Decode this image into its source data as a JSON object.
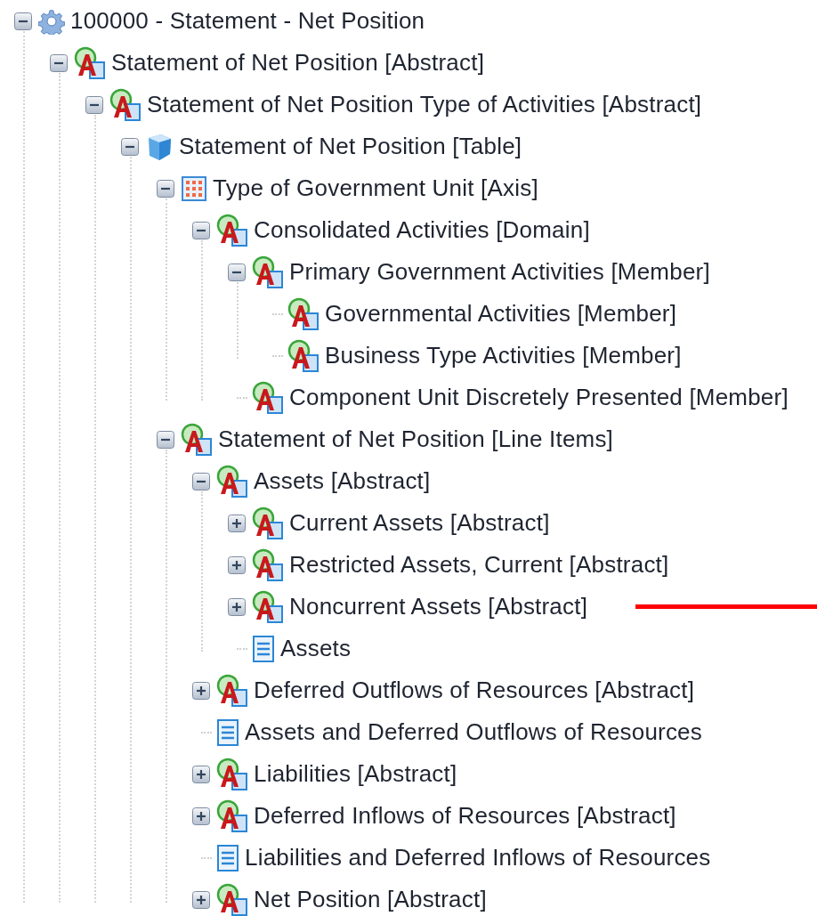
{
  "tree": {
    "label": "100000 - Statement - Net Position",
    "kind": "network",
    "expanded": true,
    "children": [
      {
        "label": "Statement of Net Position [Abstract]",
        "kind": "abstract",
        "expanded": true,
        "children": [
          {
            "label": "Statement of Net Position Type of Activities [Abstract]",
            "kind": "abstract",
            "expanded": true,
            "children": [
              {
                "label": "Statement of Net Position [Table]",
                "kind": "table",
                "expanded": true,
                "children": [
                  {
                    "label": "Type of Government Unit [Axis]",
                    "kind": "axis",
                    "expanded": true,
                    "children": [
                      {
                        "label": "Consolidated Activities [Domain]",
                        "kind": "abstract",
                        "expanded": true,
                        "children": [
                          {
                            "label": "Primary Government Activities [Member]",
                            "kind": "abstract",
                            "expanded": true,
                            "children": [
                              {
                                "label": "Governmental Activities [Member]",
                                "kind": "abstract"
                              },
                              {
                                "label": "Business Type Activities [Member]",
                                "kind": "abstract"
                              }
                            ]
                          },
                          {
                            "label": "Component Unit Discretely Presented [Member]",
                            "kind": "abstract"
                          }
                        ]
                      }
                    ]
                  },
                  {
                    "label": "Statement of Net Position [Line Items]",
                    "kind": "abstract",
                    "expanded": true,
                    "children": [
                      {
                        "label": "Assets [Abstract]",
                        "kind": "abstract",
                        "expanded": true,
                        "children": [
                          {
                            "label": "Current Assets [Abstract]",
                            "kind": "abstract",
                            "expanded": false
                          },
                          {
                            "label": "Restricted Assets, Current [Abstract]",
                            "kind": "abstract",
                            "expanded": false
                          },
                          {
                            "label": "Noncurrent Assets [Abstract]",
                            "kind": "abstract",
                            "expanded": false,
                            "pointer_line": true
                          },
                          {
                            "label": "Assets",
                            "kind": "concept"
                          }
                        ]
                      },
                      {
                        "label": "Deferred Outflows of Resources [Abstract]",
                        "kind": "abstract",
                        "expanded": false
                      },
                      {
                        "label": "Assets and Deferred Outflows of Resources",
                        "kind": "concept"
                      },
                      {
                        "label": "Liabilities [Abstract]",
                        "kind": "abstract",
                        "expanded": false
                      },
                      {
                        "label": "Deferred Inflows of Resources [Abstract]",
                        "kind": "abstract",
                        "expanded": false
                      },
                      {
                        "label": "Liabilities and Deferred Inflows of Resources",
                        "kind": "concept"
                      },
                      {
                        "label": "Net Position [Abstract]",
                        "kind": "abstract",
                        "expanded": false
                      }
                    ]
                  }
                ]
              }
            ]
          }
        ]
      }
    ]
  }
}
